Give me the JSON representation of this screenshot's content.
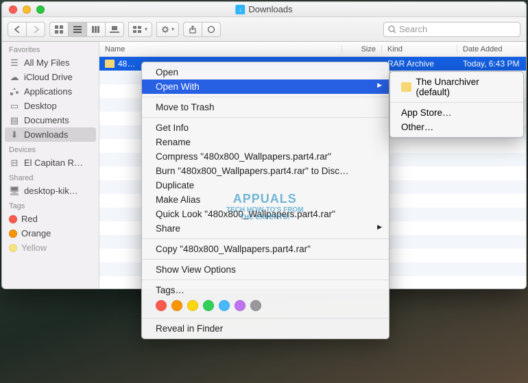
{
  "window": {
    "title": "Downloads"
  },
  "toolbar": {
    "search_placeholder": "Search"
  },
  "sidebar": {
    "sections": [
      {
        "label": "Favorites",
        "items": [
          {
            "label": "All My Files",
            "icon": "all-files-icon",
            "sel": false
          },
          {
            "label": "iCloud Drive",
            "icon": "cloud-icon",
            "sel": false
          },
          {
            "label": "Applications",
            "icon": "apps-icon",
            "sel": false
          },
          {
            "label": "Desktop",
            "icon": "desktop-icon",
            "sel": false
          },
          {
            "label": "Documents",
            "icon": "documents-icon",
            "sel": false
          },
          {
            "label": "Downloads",
            "icon": "downloads-icon",
            "sel": true
          }
        ]
      },
      {
        "label": "Devices",
        "items": [
          {
            "label": "El Capitan R…",
            "icon": "disk-icon",
            "sel": false
          }
        ]
      },
      {
        "label": "Shared",
        "items": [
          {
            "label": "desktop-kik…",
            "icon": "shared-icon",
            "sel": false
          }
        ]
      },
      {
        "label": "Tags",
        "items": [
          {
            "label": "Red",
            "color": "#ff5a4e"
          },
          {
            "label": "Orange",
            "color": "#ff9500"
          },
          {
            "label": "Yellow",
            "color": "#ffd60a"
          }
        ]
      }
    ]
  },
  "columns": {
    "name": "Name",
    "size": "Size",
    "kind": "Kind",
    "date": "Date Added"
  },
  "rows": [
    {
      "name": "480x800_Wallpapers.part4.rar",
      "short": "48…",
      "size": "",
      "kind": "RAR Archive",
      "date": "Today, 6:43 PM"
    }
  ],
  "context_menu": {
    "open": "Open",
    "open_with": "Open With",
    "trash": "Move to Trash",
    "get_info": "Get Info",
    "rename": "Rename",
    "compress": "Compress \"480x800_Wallpapers.part4.rar\"",
    "burn": "Burn \"480x800_Wallpapers.part4.rar\" to Disc…",
    "duplicate": "Duplicate",
    "alias": "Make Alias",
    "quicklook": "Quick Look \"480x800_Wallpapers.part4.rar\"",
    "share": "Share",
    "copy": "Copy \"480x800_Wallpapers.part4.rar\"",
    "view_opts": "Show View Options",
    "tags": "Tags…",
    "tag_colors": [
      "#ff5a4e",
      "#ff9500",
      "#ffd60a",
      "#30d158",
      "#48b9ff",
      "#c074f1",
      "#98989d"
    ],
    "reveal": "Reveal in Finder"
  },
  "submenu": {
    "default_app": "The Unarchiver (default)",
    "app_store": "App Store…",
    "other": "Other…"
  },
  "watermark": {
    "brand": "APPUALS",
    "tag1": "TECH HOW-TO'S FROM",
    "tag2": "THE EXPERTS!"
  }
}
